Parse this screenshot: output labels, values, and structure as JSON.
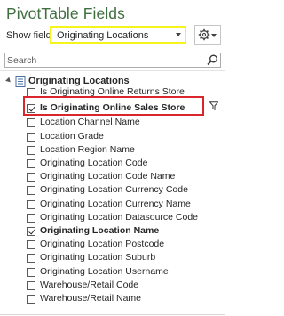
{
  "pane": {
    "title": "PivotTable Fields"
  },
  "show_fields": {
    "label": "Show fields:",
    "value": "Originating Locations"
  },
  "tools": {
    "icon": "gear-icon"
  },
  "search": {
    "placeholder": "Search",
    "icon": "search-icon"
  },
  "colors": {
    "title": "#3f6f3f",
    "dropdown_highlight": "#f5f51b",
    "row_highlight": "#d9262b"
  },
  "table": {
    "name": "Originating Locations",
    "expanded": true,
    "icon": "table-icon",
    "fields": [
      {
        "label": "Is Originating Online Returns Store",
        "checked": false,
        "bold": false
      },
      {
        "label": "Is Originating Online Sales Store",
        "checked": true,
        "bold": true,
        "filtered": true,
        "highlighted": true
      },
      {
        "label": "Location Channel Name",
        "checked": false,
        "bold": false
      },
      {
        "label": "Location Grade",
        "checked": false,
        "bold": false
      },
      {
        "label": "Location Region Name",
        "checked": false,
        "bold": false
      },
      {
        "label": "Originating Location Code",
        "checked": false,
        "bold": false
      },
      {
        "label": "Originating Location Code Name",
        "checked": false,
        "bold": false
      },
      {
        "label": "Originating Location Currency Code",
        "checked": false,
        "bold": false
      },
      {
        "label": "Originating Location Currency Name",
        "checked": false,
        "bold": false
      },
      {
        "label": "Originating Location Datasource Code",
        "checked": false,
        "bold": false
      },
      {
        "label": "Originating Location Name",
        "checked": true,
        "bold": true
      },
      {
        "label": "Originating Location Postcode",
        "checked": false,
        "bold": false
      },
      {
        "label": "Originating Location Suburb",
        "checked": false,
        "bold": false
      },
      {
        "label": "Originating Location Username",
        "checked": false,
        "bold": false
      },
      {
        "label": "Warehouse/Retail Code",
        "checked": false,
        "bold": false
      },
      {
        "label": "Warehouse/Retail Name",
        "checked": false,
        "bold": false
      }
    ]
  }
}
